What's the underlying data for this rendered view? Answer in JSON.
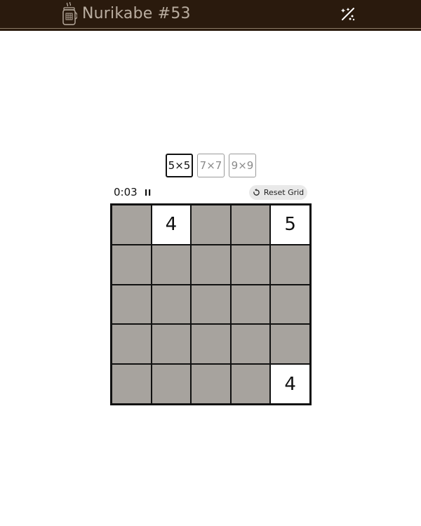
{
  "header": {
    "title": "Nurikabe #53",
    "logo_icon": "coffee-jar-icon",
    "theme_icon": "theme-toggle-icon",
    "bar_color": "#2a1a0d"
  },
  "size_options": [
    {
      "label": "5×5",
      "active": true
    },
    {
      "label": "7×7",
      "active": false
    },
    {
      "label": "9×9",
      "active": false
    }
  ],
  "controls": {
    "timer": "0:03",
    "pause_icon": "pause-icon",
    "reset_label": "Reset Grid",
    "reset_icon": "reset-icon"
  },
  "grid": {
    "rows": 5,
    "cols": 5,
    "shaded_color": "#a7a39e",
    "cells": [
      [
        {
          "state": "shaded",
          "value": ""
        },
        {
          "state": "white",
          "value": "4"
        },
        {
          "state": "shaded",
          "value": ""
        },
        {
          "state": "shaded",
          "value": ""
        },
        {
          "state": "white",
          "value": "5"
        }
      ],
      [
        {
          "state": "shaded",
          "value": ""
        },
        {
          "state": "shaded",
          "value": ""
        },
        {
          "state": "shaded",
          "value": ""
        },
        {
          "state": "shaded",
          "value": ""
        },
        {
          "state": "shaded",
          "value": ""
        }
      ],
      [
        {
          "state": "shaded",
          "value": ""
        },
        {
          "state": "shaded",
          "value": ""
        },
        {
          "state": "shaded",
          "value": ""
        },
        {
          "state": "shaded",
          "value": ""
        },
        {
          "state": "shaded",
          "value": ""
        }
      ],
      [
        {
          "state": "shaded",
          "value": ""
        },
        {
          "state": "shaded",
          "value": ""
        },
        {
          "state": "shaded",
          "value": ""
        },
        {
          "state": "shaded",
          "value": ""
        },
        {
          "state": "shaded",
          "value": ""
        }
      ],
      [
        {
          "state": "shaded",
          "value": ""
        },
        {
          "state": "shaded",
          "value": ""
        },
        {
          "state": "shaded",
          "value": ""
        },
        {
          "state": "shaded",
          "value": ""
        },
        {
          "state": "white",
          "value": "4"
        }
      ]
    ]
  }
}
